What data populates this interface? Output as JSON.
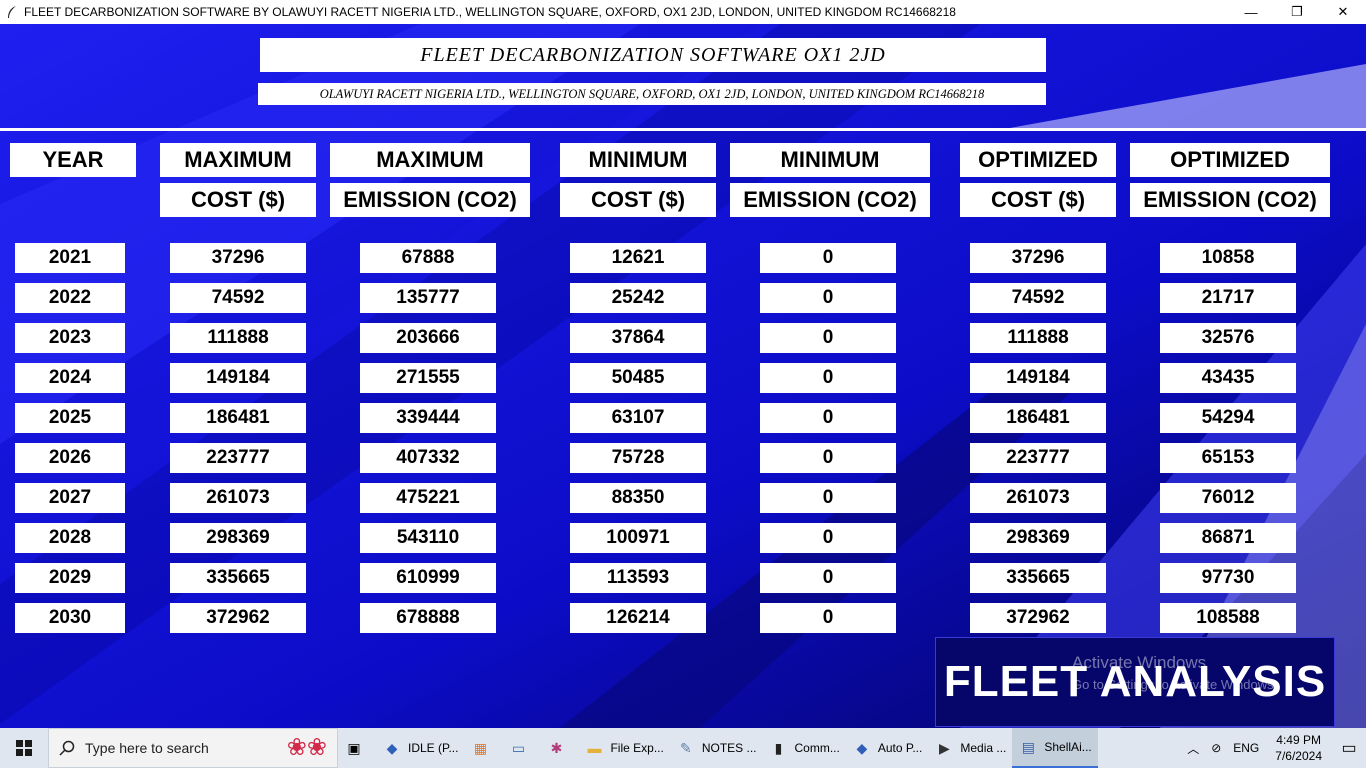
{
  "window": {
    "title": "FLEET DECARBONIZATION SOFTWARE BY OLAWUYI RACETT NIGERIA LTD., WELLINGTON SQUARE, OXFORD, OX1 2JD, LONDON, UNITED KINGDOM RC14668218",
    "minimize": "—",
    "maximize": "❐",
    "close": "✕"
  },
  "header": {
    "app_title": "FLEET DECARBONIZATION SOFTWARE OX1 2JD",
    "company_line": "OLAWUYI RACETT NIGERIA LTD., WELLINGTON SQUARE, OXFORD, OX1 2JD, LONDON, UNITED KINGDOM RC14668218"
  },
  "columns": {
    "year": "YEAR",
    "max_cost": [
      "MAXIMUM",
      "COST ($)"
    ],
    "max_emission": [
      "MAXIMUM",
      "EMISSION (CO2)"
    ],
    "min_cost": [
      "MINIMUM",
      "COST ($)"
    ],
    "min_emission": [
      "MINIMUM",
      "EMISSION (CO2)"
    ],
    "opt_cost": [
      "OPTIMIZED",
      "COST ($)"
    ],
    "opt_emission": [
      "OPTIMIZED",
      "EMISSION (CO2)"
    ]
  },
  "rows": [
    [
      "2021",
      "37296",
      "67888",
      "12621",
      "0",
      "37296",
      "10858"
    ],
    [
      "2022",
      "74592",
      "135777",
      "25242",
      "0",
      "74592",
      "21717"
    ],
    [
      "2023",
      "111888",
      "203666",
      "37864",
      "0",
      "111888",
      "32576"
    ],
    [
      "2024",
      "149184",
      "271555",
      "50485",
      "0",
      "149184",
      "43435"
    ],
    [
      "2025",
      "186481",
      "339444",
      "63107",
      "0",
      "186481",
      "54294"
    ],
    [
      "2026",
      "223777",
      "407332",
      "75728",
      "0",
      "223777",
      "65153"
    ],
    [
      "2027",
      "261073",
      "475221",
      "88350",
      "0",
      "261073",
      "76012"
    ],
    [
      "2028",
      "298369",
      "543110",
      "100971",
      "0",
      "298369",
      "86871"
    ],
    [
      "2029",
      "335665",
      "610999",
      "113593",
      "0",
      "335665",
      "97730"
    ],
    [
      "2030",
      "372962",
      "678888",
      "126214",
      "0",
      "372962",
      "108588"
    ]
  ],
  "fleet_button": "FLEET ANALYSIS",
  "watermark": {
    "line1": "Activate Windows",
    "line2": "Go to Settings to activate Windows."
  },
  "taskbar": {
    "search_placeholder": "Type here to search",
    "apps": [
      {
        "label": "IDLE (P...",
        "icon": "python-icon"
      },
      {
        "label": "File Exp...",
        "icon": "folder-icon"
      },
      {
        "label": "NOTES ...",
        "icon": "notes-icon"
      },
      {
        "label": "Comm...",
        "icon": "terminal-icon"
      },
      {
        "label": "Auto P...",
        "icon": "python-icon"
      },
      {
        "label": "Media ...",
        "icon": "media-icon"
      },
      {
        "label": "ShellAi...",
        "icon": "shell-icon"
      }
    ],
    "language": "ENG",
    "time": "4:49 PM",
    "date": "7/6/2024"
  }
}
